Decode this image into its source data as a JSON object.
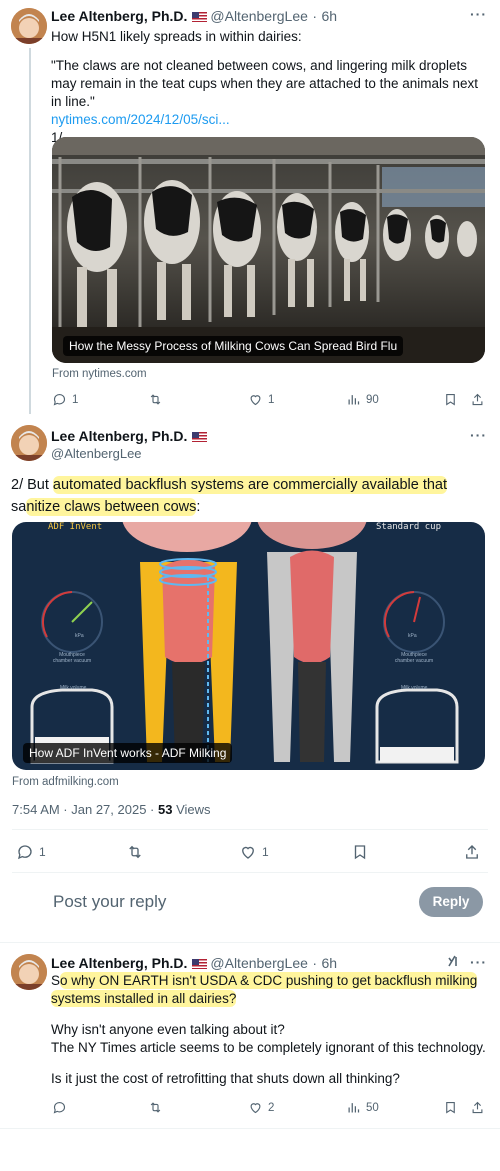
{
  "tweet1": {
    "name": "Lee Altenberg, Ph.D.",
    "handle": "@AltenbergLee",
    "separator": "·",
    "time": "6h",
    "line1": "How H5N1 likely spreads in within dairies:",
    "quote": "\"The claws are not cleaned between cows, and lingering milk droplets may remain in the teat cups when they are attached to the animals next in line.\"",
    "link": "nytimes.com/2024/12/05/sci...",
    "numbering": "1/",
    "card_caption": "How the Messy Process of Milking Cows Can Spread Bird Flu",
    "card_from": "From nytimes.com",
    "replies": "1",
    "likes": "1",
    "views": "90"
  },
  "tweet2": {
    "name": "Lee Altenberg, Ph.D.",
    "handle": "@AltenbergLee",
    "text_prefix": "2/ But ",
    "text_hl1": "automated backflush systems are commercially available that",
    "text_hl2a": "sa",
    "text_hl2b": "nitize claws between cows",
    "text_suffix": ":",
    "card_label_left": "ADF InVent",
    "card_label_right": "Standard cup",
    "gauge_label": "kPa",
    "gauge_sub_left": "Mouthpiece chamber vacuum",
    "gauge_sub_right": "Mouthpiece chamber vacuum",
    "milk_label_left": "Milk volume",
    "milk_label_right": "Milk volume",
    "card_caption": "How ADF InVent works - ADF Milking",
    "card_from": "From adfmilking.com",
    "timestamp": "7:54 AM · Jan 27, 2025 · ",
    "views_count": "53",
    "views_label": " Views",
    "replies": "1",
    "likes": "1"
  },
  "reply_box": {
    "placeholder": "Post your reply",
    "button": "Reply"
  },
  "tweet3": {
    "name": "Lee Altenberg, Ph.D.",
    "handle": "@AltenbergLee",
    "separator": "·",
    "time": "6h",
    "line1_a": "S",
    "line1_b": "o why ON EARTH isn't USDA & CDC pushing to get backflush milking",
    "line2": "systems installed in all dairies?",
    "para2_l1": "Why isn't anyone even talking about it?",
    "para2_l2": "The NY Times article seems to be completely ignorant of this technology.",
    "para3": "Is it just the cost of retrofitting that shuts down all thinking?",
    "likes": "2",
    "views": "50"
  },
  "colors": {
    "accent": "#1d9bf0",
    "highlight": "#fff59d",
    "reply_button": "#8b98a5"
  }
}
